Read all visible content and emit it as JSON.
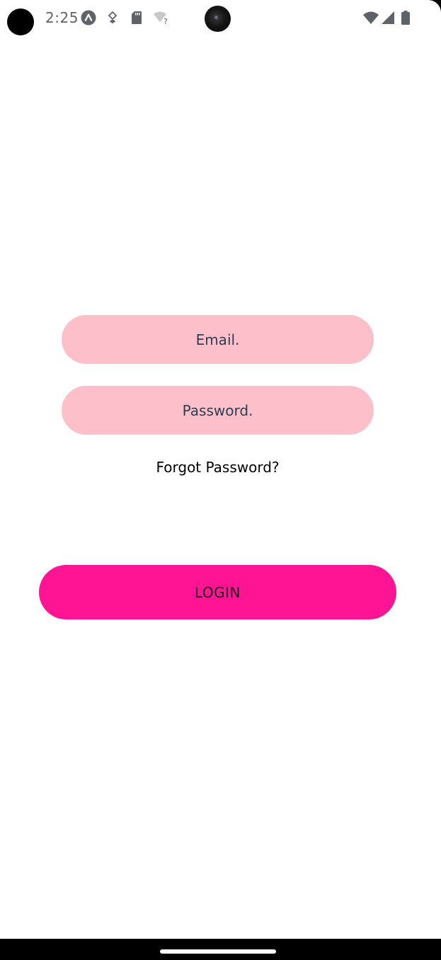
{
  "status_bar": {
    "time": "2:25",
    "icons": [
      "app-a-icon",
      "shield-heart-icon",
      "sd-card-icon",
      "wifi-question-icon",
      "wifi-icon",
      "signal-icon",
      "battery-icon"
    ]
  },
  "login_form": {
    "email_placeholder": "Email.",
    "password_placeholder": "Password.",
    "forgot_password_label": "Forgot Password?",
    "login_button_label": "LOGIN"
  },
  "colors": {
    "field_background": "#fdc0cb",
    "field_text": "#2c3e50",
    "button_background": "#ff1493",
    "screen_background": "#ffffff"
  }
}
